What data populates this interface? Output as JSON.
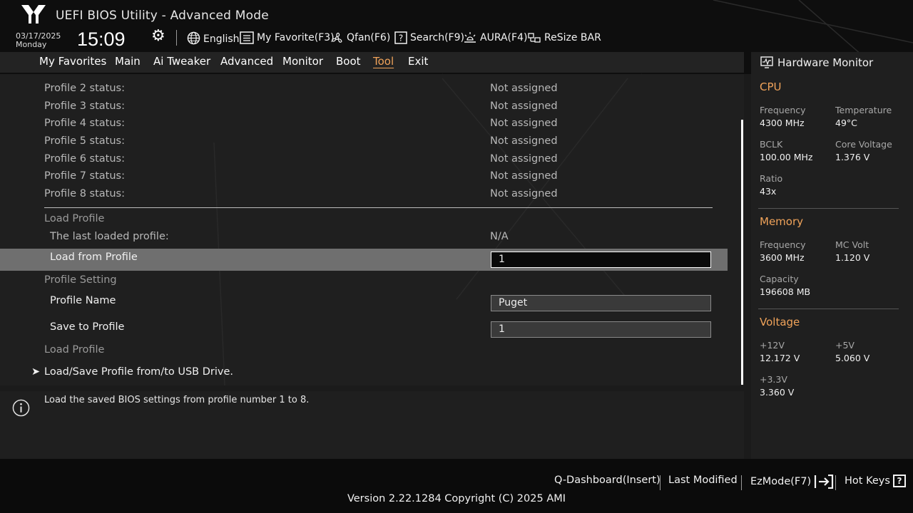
{
  "header": {
    "title": "UEFI BIOS Utility - Advanced Mode",
    "date": "03/17/2025",
    "day": "Monday",
    "time": "15:09"
  },
  "toolbar": {
    "language": "English",
    "my_favorite": "My Favorite(F3)",
    "qfan": "Qfan(F6)",
    "search": "Search(F9)",
    "aura": "AURA(F4)",
    "resize_bar": "ReSize BAR"
  },
  "tabs": [
    {
      "label": "My Favorites"
    },
    {
      "label": "Main"
    },
    {
      "label": "Ai Tweaker"
    },
    {
      "label": "Advanced"
    },
    {
      "label": "Monitor"
    },
    {
      "label": "Boot"
    },
    {
      "label": "Tool"
    },
    {
      "label": "Exit"
    }
  ],
  "active_tab": "Tool",
  "profiles": [
    {
      "label": "Profile 2 status:",
      "value": "Not assigned"
    },
    {
      "label": "Profile 3 status:",
      "value": "Not assigned"
    },
    {
      "label": "Profile 4 status:",
      "value": "Not assigned"
    },
    {
      "label": "Profile 5 status:",
      "value": "Not assigned"
    },
    {
      "label": "Profile 6 status:",
      "value": "Not assigned"
    },
    {
      "label": "Profile 7 status:",
      "value": "Not assigned"
    },
    {
      "label": "Profile 8 status:",
      "value": "Not assigned"
    }
  ],
  "load_profile": {
    "heading": "Load Profile",
    "last_loaded_label": "The last loaded profile:",
    "last_loaded_value": "N/A",
    "load_from_label": "Load from Profile",
    "load_from_value": "1"
  },
  "profile_setting": {
    "heading": "Profile Setting",
    "name_label": "Profile Name",
    "name_value": "Puget",
    "save_label": "Save to Profile",
    "save_value": "1"
  },
  "load_profile_2": {
    "heading": "Load Profile",
    "usb_link": "Load/Save Profile from/to USB Drive."
  },
  "help": {
    "text": "Load the saved BIOS settings from profile number 1 to 8."
  },
  "hardware_monitor": {
    "title": "Hardware Monitor",
    "cpu": {
      "heading": "CPU",
      "frequency_label": "Frequency",
      "frequency": "4300 MHz",
      "temperature_label": "Temperature",
      "temperature": "49°C",
      "bclk_label": "BCLK",
      "bclk": "100.00 MHz",
      "core_voltage_label": "Core Voltage",
      "core_voltage": "1.376 V",
      "ratio_label": "Ratio",
      "ratio": "43x"
    },
    "memory": {
      "heading": "Memory",
      "frequency_label": "Frequency",
      "frequency": "3600 MHz",
      "mc_volt_label": "MC Volt",
      "mc_volt": "1.120 V",
      "capacity_label": "Capacity",
      "capacity": "196608 MB"
    },
    "voltage": {
      "heading": "Voltage",
      "v12_label": "+12V",
      "v12": "12.172 V",
      "v5_label": "+5V",
      "v5": "5.060 V",
      "v33_label": "+3.3V",
      "v33": "3.360 V"
    }
  },
  "footer": {
    "q_dashboard": "Q-Dashboard(Insert)",
    "last_modified": "Last Modified",
    "ezmode": "EzMode(F7)",
    "hot_keys": "Hot Keys",
    "version": "Version 2.22.1284 Copyright (C) 2025 AMI"
  },
  "colors": {
    "accent": "#f0a35a",
    "background": "#1b1b1b",
    "highlight_row": "#6f6f6f"
  },
  "icons": [
    "tuf-logo-icon",
    "gear-icon",
    "globe-icon",
    "favorite-list-icon",
    "fan-icon",
    "search-help-icon",
    "aura-light-icon",
    "resize-bar-icon",
    "info-icon",
    "hardware-monitor-icon",
    "exit-arrow-icon",
    "question-icon"
  ]
}
